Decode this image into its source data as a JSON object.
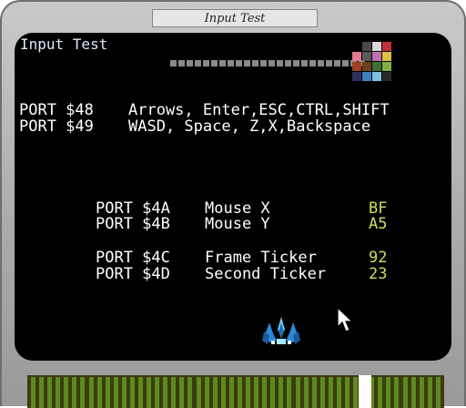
{
  "cartridge": {
    "label": "Input Test"
  },
  "screen": {
    "title": "Input Test",
    "ports": [
      {
        "port": "PORT $48",
        "desc": "Arrows, Enter,ESC,CTRL,SHIFT"
      },
      {
        "port": "PORT $49",
        "desc": "WASD, Space, Z,X,Backspace"
      }
    ],
    "readouts": [
      {
        "port": "PORT $4A",
        "desc": "Mouse X",
        "value": "BF"
      },
      {
        "port": "PORT $4B",
        "desc": "Mouse Y",
        "value": "A5"
      },
      {
        "port": "PORT $4C",
        "desc": "Frame Ticker",
        "value": "92"
      },
      {
        "port": "PORT $4D",
        "desc": "Second Ticker",
        "value": "23"
      }
    ],
    "input_indicators": 24,
    "palette": [
      "#000000",
      "#4a4a4a",
      "#d8d8d8",
      "#c0303a",
      "#e07a8a",
      "#5a5a5a",
      "#c070b0",
      "#e0c040",
      "#a04020",
      "#6a4020",
      "#3a7030",
      "#80b040",
      "#303060",
      "#4080c0",
      "#80c0e0",
      "#2a2a2a"
    ]
  },
  "colors": {
    "screen_bg": "#000000",
    "text": "#ffffff",
    "value_text": "#c8e05a",
    "shell": "#b0b0b0",
    "connector_pin": "#5d8a1c"
  }
}
